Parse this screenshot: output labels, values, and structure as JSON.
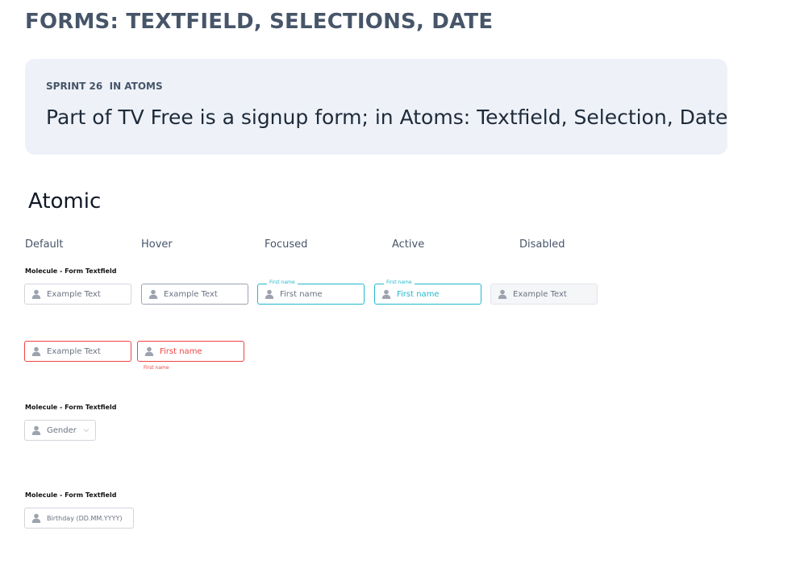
{
  "page": {
    "title": "FORMS: TEXTFIELD, SELECTIONS, DATE"
  },
  "info_card": {
    "eyebrow": "SPRINT 26  IN ATOMS",
    "body": "Part of TV Free is a signup form; in Atoms: Textfield, Selection, Date"
  },
  "section": {
    "title": "Atomic"
  },
  "states": [
    "Default",
    "Hover",
    "Focused",
    "Active",
    "Disabled"
  ],
  "textfield_group": {
    "label": "Molecule - Form Textfield",
    "fields": [
      {
        "state": "default",
        "value": "Example Text",
        "icon": "user-icon"
      },
      {
        "state": "hover",
        "value": "Example Text",
        "icon": "user-icon"
      },
      {
        "state": "focused",
        "floating_label": "First name",
        "value": "First name",
        "icon": "user-icon"
      },
      {
        "state": "active",
        "floating_label": "First name",
        "value": "First name",
        "icon": "user-icon"
      },
      {
        "state": "disabled",
        "value": "Example Text",
        "icon": "user-icon"
      }
    ],
    "error_fields": [
      {
        "state": "error",
        "value": "Example Text",
        "icon": "user-icon"
      },
      {
        "state": "error-filled",
        "value": "First name",
        "helper_text": "First name",
        "icon": "user-icon"
      }
    ]
  },
  "selection_group": {
    "label": "Molecule - Form Textfield",
    "field": {
      "value": "Gender",
      "icon": "user-icon",
      "trailing_icon": "chevron-down-icon"
    }
  },
  "date_group": {
    "label": "Molecule - Form Textfield",
    "field": {
      "value": "Birthday (DD.MM.YYYY)",
      "icon": "user-icon"
    }
  },
  "colors": {
    "heading": "#475569",
    "card_bg": "#eef2f8",
    "focus_accent": "#22b8cf",
    "error": "#ef4444",
    "icon": "#9ca3af"
  }
}
